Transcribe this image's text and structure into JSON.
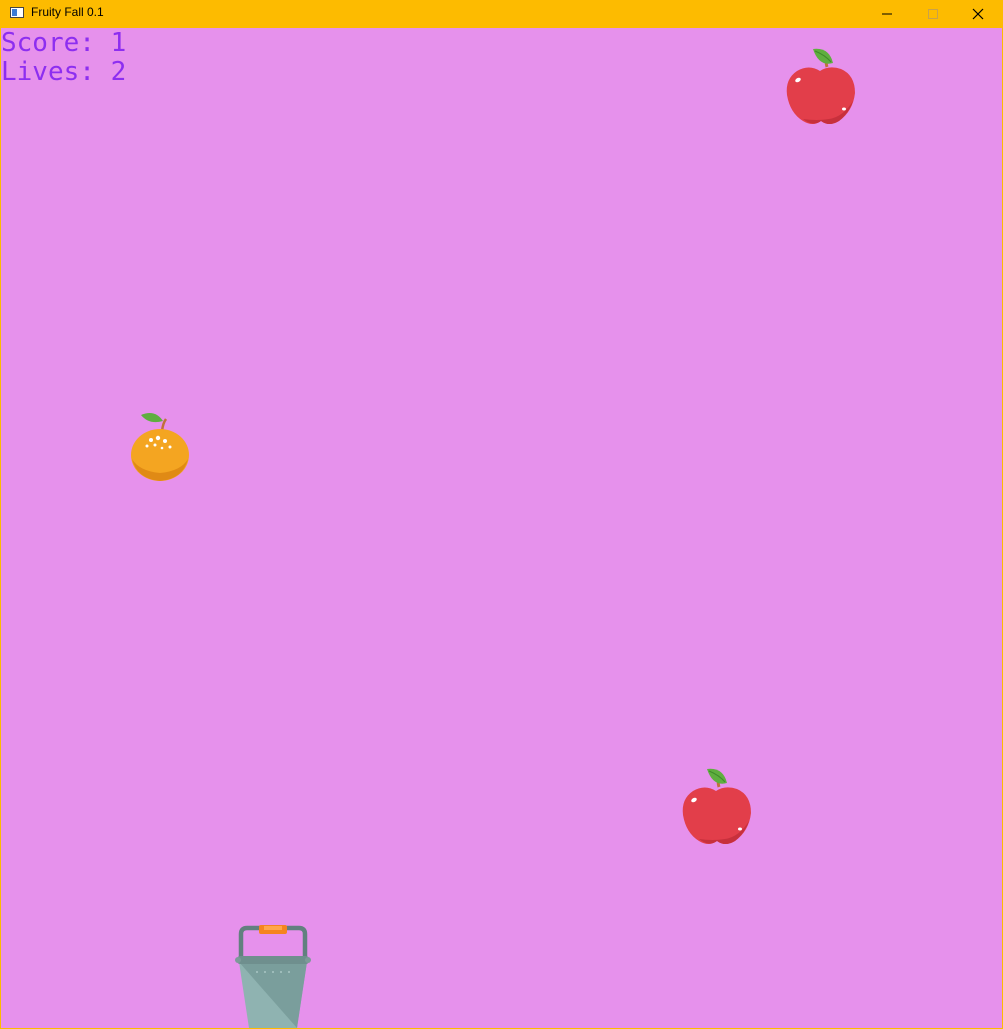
{
  "window": {
    "title": "Fruity Fall 0.1",
    "buttons": [
      "minimize",
      "maximize",
      "close"
    ]
  },
  "hud": {
    "score_label": "Score: 1",
    "lives_label": "Lives: 2",
    "text_color": "#8d2ef0"
  },
  "colors": {
    "background": "#e691ec",
    "titlebar": "#fdbb00"
  },
  "sprites": {
    "fruits": [
      "apple",
      "orange",
      "apple"
    ],
    "player": "bucket"
  }
}
